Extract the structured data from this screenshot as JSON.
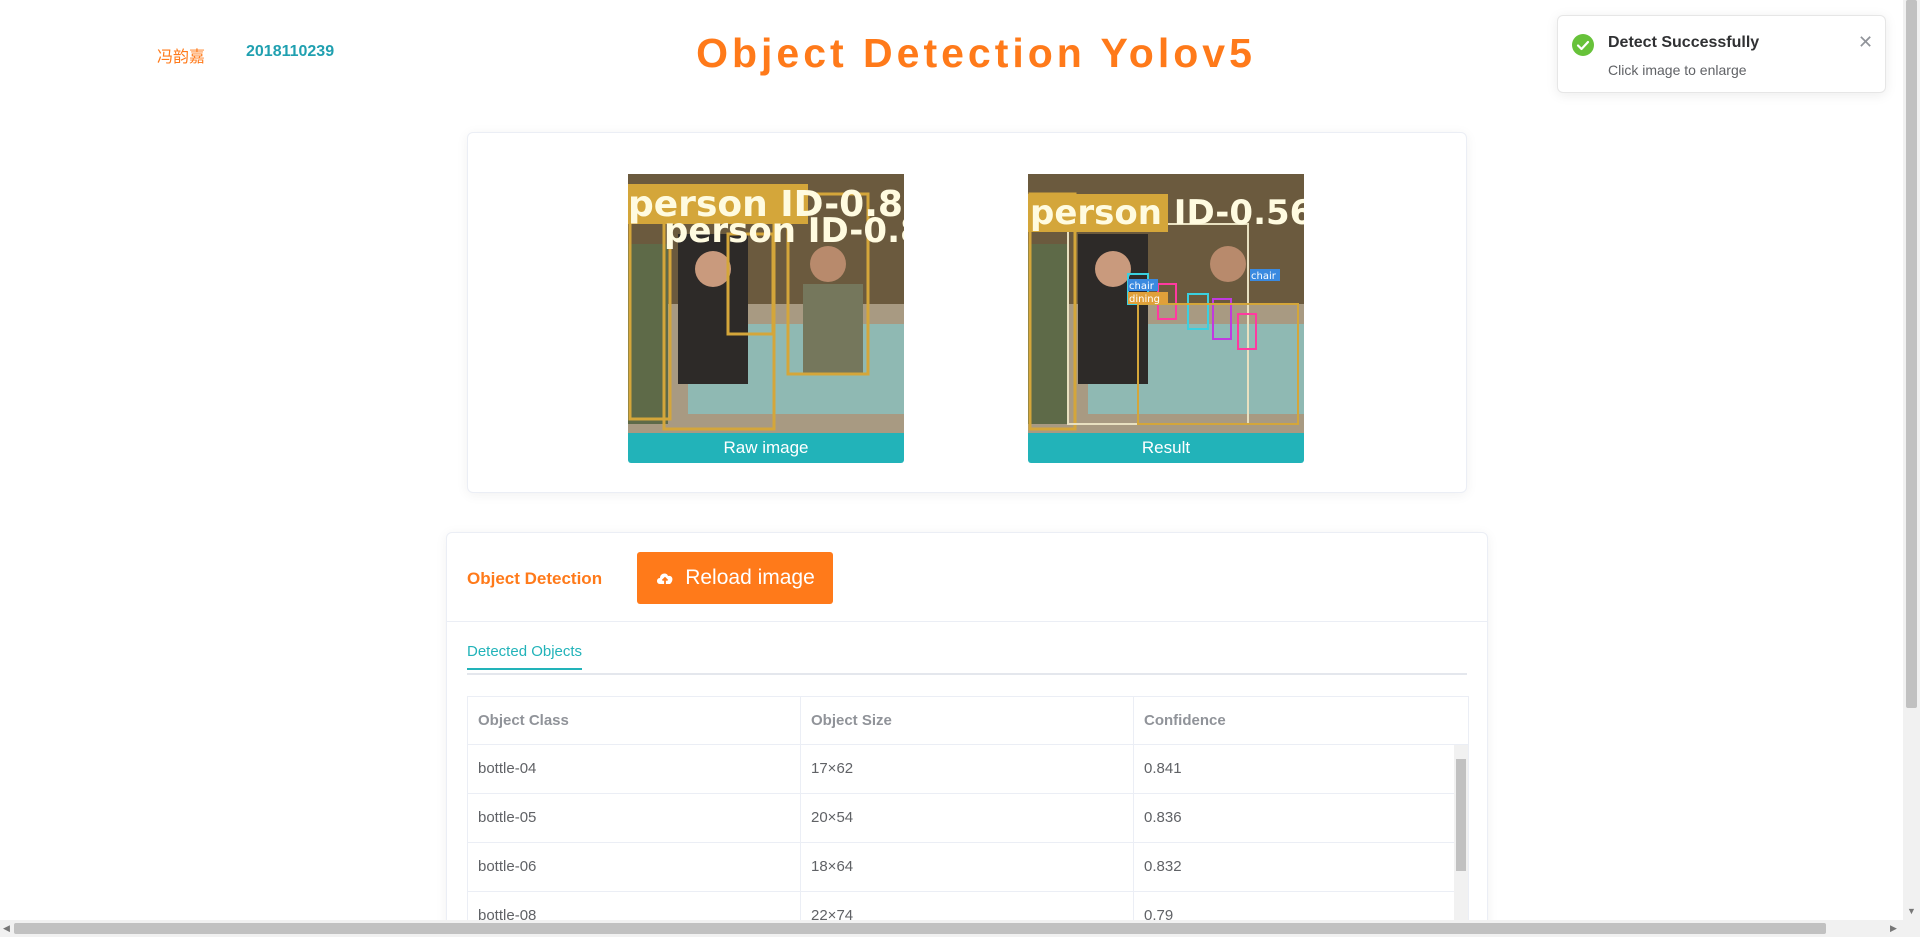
{
  "header": {
    "user_name": "冯韵嘉",
    "student_id": "2018110239",
    "title": "Object Detection Yolov5"
  },
  "toast": {
    "title": "Detect Successfully",
    "message": "Click image to enlarge",
    "icon": "check-circle-icon",
    "close_icon": "close-icon"
  },
  "images": {
    "raw_caption": "Raw image",
    "result_caption": "Result"
  },
  "detection": {
    "section_title": "Object Detection",
    "reload_label": "Reload image",
    "reload_icon": "cloud-upload-icon",
    "tab_label": "Detected Objects",
    "columns": [
      "Object Class",
      "Object Size",
      "Confidence"
    ],
    "rows": [
      [
        "bottle-04",
        "17×62",
        "0.841"
      ],
      [
        "bottle-05",
        "20×54",
        "0.836"
      ],
      [
        "bottle-06",
        "18×64",
        "0.832"
      ],
      [
        "bottle-08",
        "22×74",
        "0.79"
      ]
    ]
  },
  "colors": {
    "accent_orange": "#ff7a1a",
    "accent_teal": "#22b3b9",
    "success_green": "#67c23a"
  }
}
